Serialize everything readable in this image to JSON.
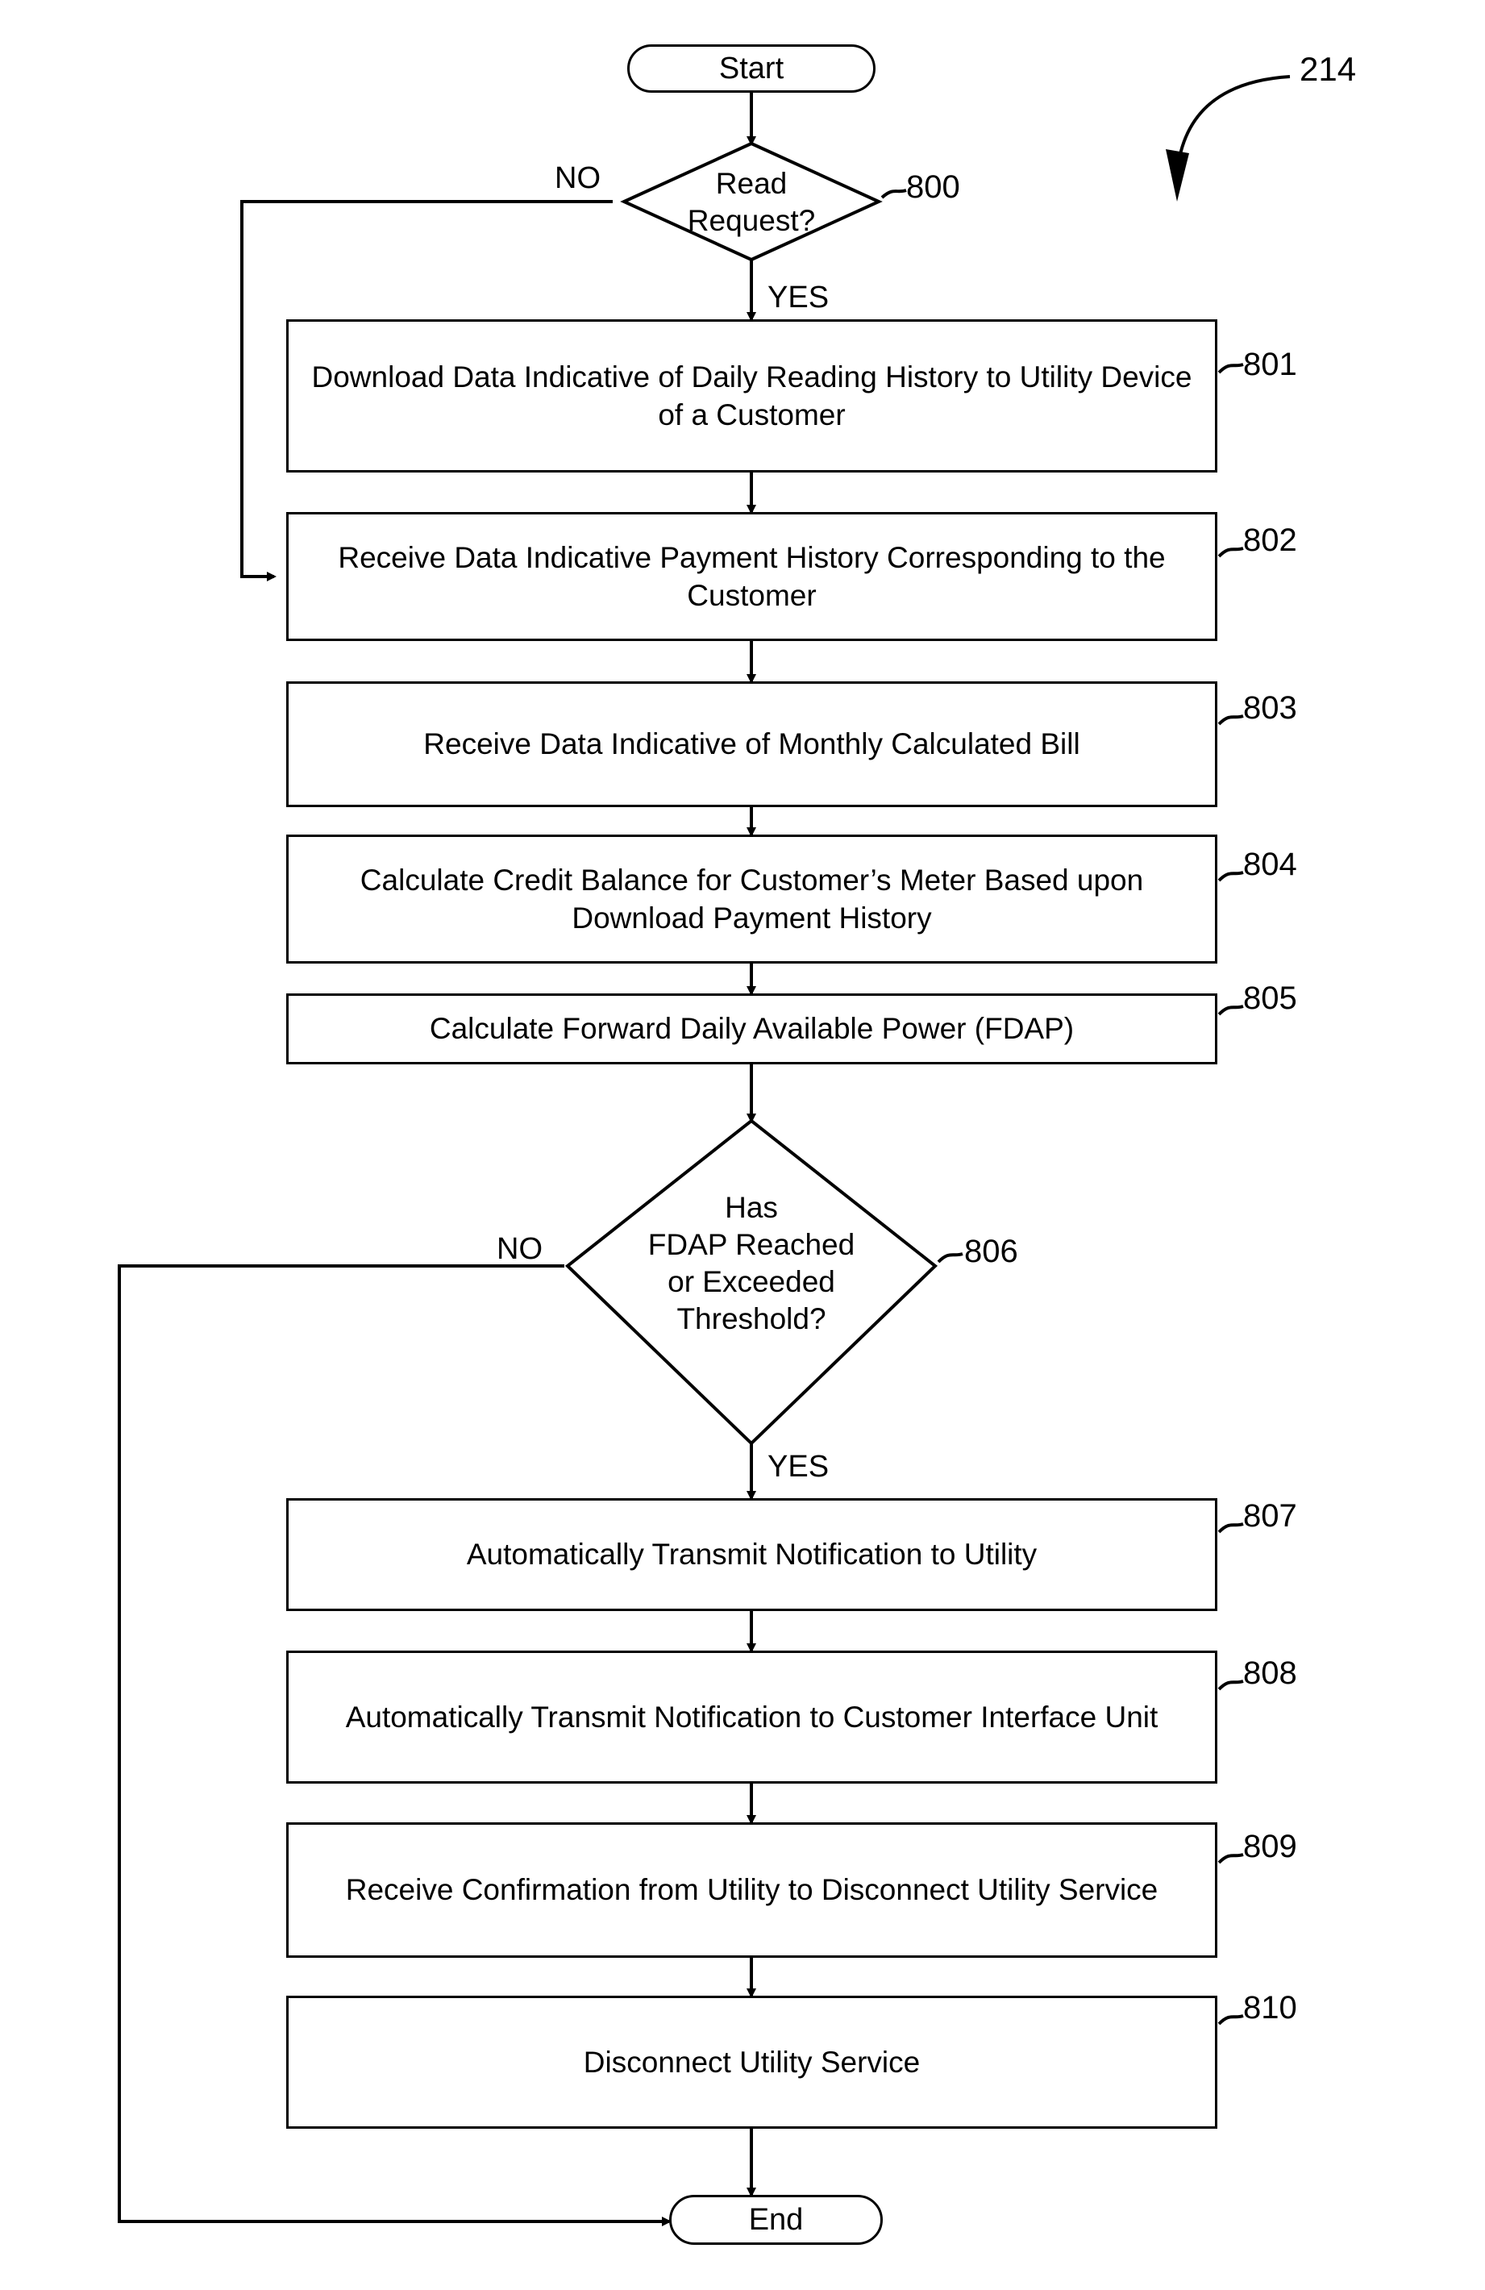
{
  "figure": {
    "number": "214",
    "type": "flowchart"
  },
  "nodes": {
    "start": {
      "label": "Start"
    },
    "decision_read_request": {
      "label": "Read\nRequest?",
      "tag": "800"
    },
    "step_801": {
      "label": "Download Data Indicative of Daily Reading History to Utility Device of a Customer",
      "tag": "801"
    },
    "step_802": {
      "label": "Receive Data Indicative Payment History Corresponding to the Customer",
      "tag": "802"
    },
    "step_803": {
      "label": "Receive Data Indicative of Monthly Calculated Bill",
      "tag": "803"
    },
    "step_804": {
      "label": "Calculate Credit Balance for Customer’s Meter Based upon Download Payment History",
      "tag": "804"
    },
    "step_805": {
      "label": "Calculate Forward Daily Available Power (FDAP)",
      "tag": "805"
    },
    "decision_fdap": {
      "label": "Has\nFDAP Reached\nor Exceeded\nThreshold?",
      "tag": "806"
    },
    "step_807": {
      "label": "Automatically Transmit Notification to Utility",
      "tag": "807"
    },
    "step_808": {
      "label": "Automatically Transmit Notification to Customer Interface Unit",
      "tag": "808"
    },
    "step_809": {
      "label": "Receive Confirmation from Utility to Disconnect Utility Service",
      "tag": "809"
    },
    "step_810": {
      "label": "Disconnect Utility Service",
      "tag": "810"
    },
    "end": {
      "label": "End"
    }
  },
  "edge_labels": {
    "read_request_no": "NO",
    "read_request_yes": "YES",
    "fdap_no": "NO",
    "fdap_yes": "YES"
  }
}
